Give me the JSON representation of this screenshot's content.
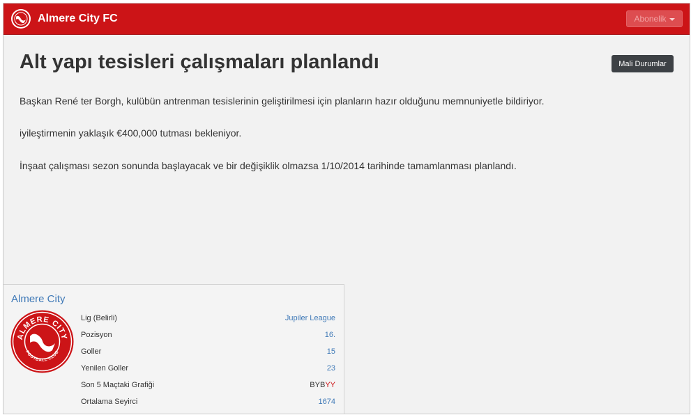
{
  "navbar": {
    "brand": "Almere City FC",
    "subscribe_label": "Abonelik"
  },
  "article": {
    "title": "Alt yapı tesisleri çalışmaları planlandı",
    "finance_button": "Mali Durumlar",
    "paragraphs": [
      "Başkan René ter Borgh, kulübün antrenman tesislerinin geliştirilmesi için planların hazır olduğunu memnuniyetle bildiriyor.",
      "iyileştirmenin yaklaşık €400,000 tutması bekleniyor.",
      "İnşaat çalışması sezon sonunda başlayacak ve bir değişiklik olmazsa 1/10/2014 tarihinde tamamlanması planlandı."
    ]
  },
  "club_card": {
    "name": "Almere City",
    "logo_text_top": "ALMERE CITY",
    "logo_text_bottom": "FOOTBALL CLUB",
    "stats": [
      {
        "label": "Lig (Belirli)",
        "value": "Jupiler League"
      },
      {
        "label": "Pozisyon",
        "value": "16."
      },
      {
        "label": "Goller",
        "value": "15"
      },
      {
        "label": "Yenilen Goller",
        "value": "23"
      },
      {
        "label": "Son 5 Maçtaki Grafiği",
        "value": ""
      },
      {
        "label": "Ortalama Seyirci",
        "value": "1674"
      }
    ],
    "form": [
      "B",
      "Y",
      "B",
      "Y",
      "Y"
    ]
  },
  "colors": {
    "brand_red": "#cc1417",
    "link_blue": "#3f79b7",
    "dark_button": "#3d4145"
  }
}
